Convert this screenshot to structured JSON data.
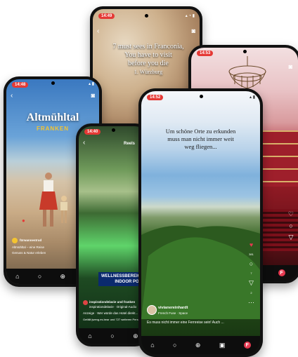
{
  "phone_a": {
    "time": "14:49",
    "overlay_lines": [
      "7 must sees in Franconia,",
      "You have to visit",
      "before you die",
      "1. Würzburg"
    ]
  },
  "phone_b": {
    "time": "14:53"
  },
  "phone_c": {
    "time": "14:48",
    "title": "Altmühltal",
    "subtitle": "FRANKEN",
    "username": "fürwannestrud",
    "caption1": "Altmühltal – eine Reise",
    "caption2": "Genuss & Natur erleben"
  },
  "phone_d": {
    "time": "14:40",
    "header": "Reels",
    "banner_line1": "WELLNESSBEREICH",
    "banner_line2": "INDOOR POOL",
    "username": "inspirationdelavie und franken",
    "audio": "inspirationdelavie · Original-Audio",
    "caption": "Anzeige · Wer würde das Hotel direkt...",
    "likes": "Gefällt jweng.es.bear und 727 weiteren Personen"
  },
  "phone_e": {
    "time": "14:52",
    "overlay_text": "Um schöne Orte zu erkunden muss man nicht immer weit weg fliegen...",
    "username": "vivianereinhardt",
    "audio": "French Fuse · Space",
    "caption": "Es muss nicht immer eine Fernreise sein! Auch ...",
    "like_count": "381",
    "comment_count": "7",
    "share_count": "2"
  },
  "icons": {
    "back": "chevron-left-icon",
    "camera": "camera-icon",
    "home": "home-icon",
    "search": "search-icon",
    "add": "plus-square-icon",
    "reels": "reels-icon",
    "heart": "heart-icon",
    "comment": "comment-icon",
    "share": "share-icon"
  },
  "colors": {
    "time_pill": "#e53935",
    "heart": "#e53950"
  }
}
